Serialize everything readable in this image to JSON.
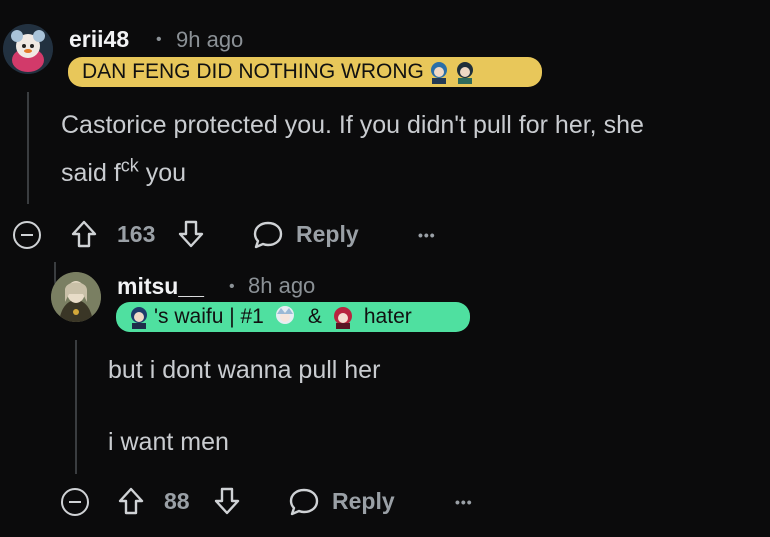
{
  "comment1": {
    "username": "erii48",
    "separator": "•",
    "time": "9h ago",
    "flair_text": "DAN FENG DID NOTHING WRONG",
    "body_line1": "Castorice protected you. If you didn't pull for her, she",
    "body_line2_prefix": "said f",
    "body_line2_sup": "ck",
    "body_line2_suffix": " you",
    "votes": "163",
    "reply_label": "Reply",
    "more_label": "•••"
  },
  "comment2": {
    "username": "mitsu__",
    "separator": "•",
    "time": "8h ago",
    "flair_part1": "'s waifu | #1",
    "flair_part2": "&",
    "flair_part3": "hater",
    "body_line1": "but i dont wanna pull her",
    "body_line2": "i want men",
    "votes": "88",
    "reply_label": "Reply",
    "more_label": "•••"
  },
  "colors": {
    "background": "#0b0b0c",
    "flair1": "#e8c75a",
    "flair2": "#4fe0a0"
  },
  "icons": [
    "avatar-erii48",
    "avatar-mitsu",
    "upvote-icon",
    "downvote-icon",
    "reply-bubble-icon",
    "collapse-icon",
    "more-icon"
  ]
}
